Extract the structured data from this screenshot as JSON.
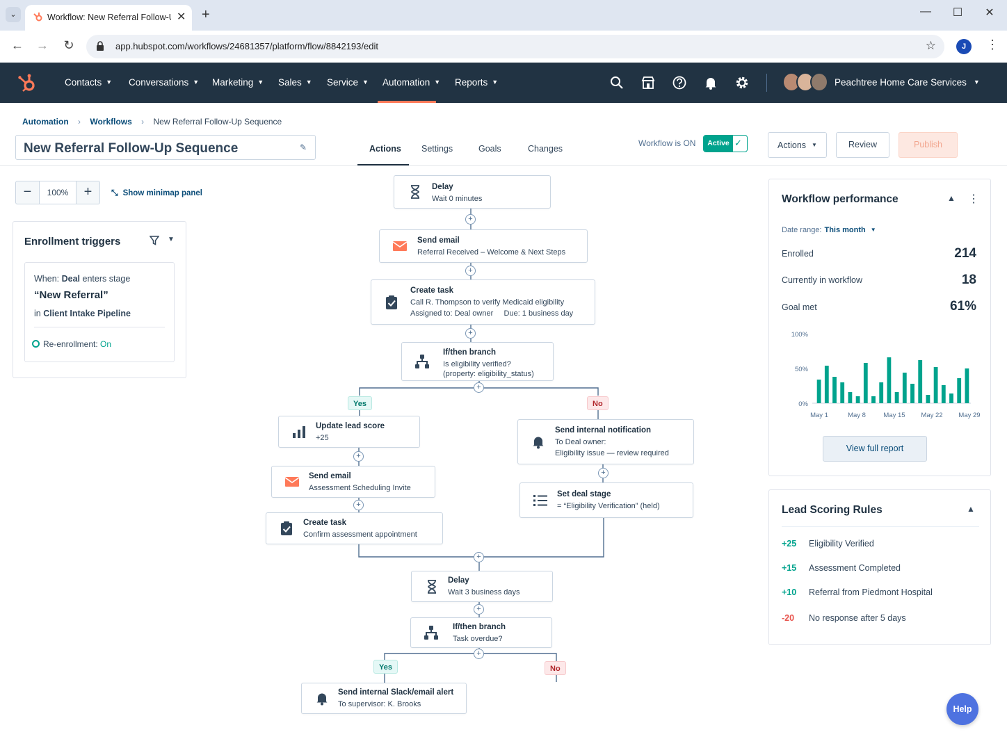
{
  "browser": {
    "tab_title": "Workflow: New Referral Follow-Up",
    "url": "app.hubspot.com/workflows/24681357/platform/flow/8842193/edit",
    "profile_initial": "J"
  },
  "nav": {
    "items": [
      {
        "label": "Contacts"
      },
      {
        "label": "Conversations"
      },
      {
        "label": "Marketing"
      },
      {
        "label": "Sales"
      },
      {
        "label": "Service"
      },
      {
        "label": "Automation"
      },
      {
        "label": "Reports"
      }
    ],
    "active": "Automation",
    "account_name": "Peachtree Home Care Services"
  },
  "breadcrumb": {
    "root": "Automation",
    "section": "Workflows",
    "current": "New Referral Follow-Up Sequence"
  },
  "workflow": {
    "title": "New Referral Follow-Up Sequence",
    "tabs": [
      "Actions",
      "Settings",
      "Goals",
      "Changes"
    ],
    "active_tab": "Actions",
    "status_text": "Workflow is ON",
    "toggle_label": "Active",
    "buttons": {
      "actions": "Actions",
      "review": "Review",
      "publish": "Publish"
    }
  },
  "zoom": {
    "value": "100%",
    "minimap_label": "Show minimap panel"
  },
  "enrollment": {
    "title": "Enrollment triggers",
    "when_prefix": "When:",
    "object": "Deal",
    "action": "enters stage",
    "stage": "“New Referral”",
    "in_prefix": "in",
    "pipeline": "Client Intake Pipeline",
    "reenroll_label": "Re-enrollment:",
    "reenroll_value": "On"
  },
  "flow": {
    "delay1": {
      "title": "Delay",
      "sub": "Wait 0 minutes"
    },
    "email1": {
      "title": "Send email",
      "sub": "Referral Received – Welcome & Next Steps"
    },
    "task1": {
      "title": "Create task",
      "sub1": "Call R. Thompson to verify Medicaid eligibility",
      "sub2": "Assigned to: Deal owner     Due: 1 business day"
    },
    "branch1": {
      "title": "If/then branch",
      "sub1": "Is eligibility verified?",
      "sub2": "(property: eligibility_status)"
    },
    "yes1": "Yes",
    "no1": "No",
    "lead_score": {
      "title": "Update lead score",
      "sub": "+25"
    },
    "email2": {
      "title": "Send email",
      "sub": "Assessment Scheduling Invite"
    },
    "task2": {
      "title": "Create task",
      "sub": "Confirm assessment appointment"
    },
    "notify": {
      "title": "Send internal notification",
      "sub1": "To Deal owner:",
      "sub2": "Eligibility issue — review required"
    },
    "deal_stage": {
      "title": "Set deal stage",
      "sub": "= “Eligibility Verification” (held)"
    },
    "delay2": {
      "title": "Delay",
      "sub": "Wait 3 business days"
    },
    "branch2": {
      "title": "If/then branch",
      "sub": "Task overdue?"
    },
    "yes2": "Yes",
    "no2": "No",
    "alert": {
      "title": "Send internal Slack/email alert",
      "sub": "To supervisor: K. Brooks"
    }
  },
  "performance": {
    "title": "Workflow performance",
    "date_range_label": "Date range:",
    "date_range_value": "This month",
    "metrics": [
      {
        "label": "Enrolled",
        "value": "214"
      },
      {
        "label": "Currently in workflow",
        "value": "18"
      },
      {
        "label": "Goal met",
        "value": "61%"
      }
    ],
    "report_button": "View full report"
  },
  "chart_data": {
    "type": "bar",
    "title": "",
    "y_ticks": [
      "100%",
      "50%",
      "0%"
    ],
    "ylim": [
      0,
      100
    ],
    "x_tick_labels": [
      "May 1",
      "May 8",
      "May 15",
      "May 22",
      "May 29"
    ],
    "values": [
      34,
      54,
      38,
      30,
      16,
      10,
      58,
      10,
      30,
      66,
      16,
      44,
      28,
      62,
      12,
      52,
      26,
      14,
      36,
      50
    ],
    "color": "#00a38d"
  },
  "lead_scoring": {
    "title": "Lead Scoring Rules",
    "rules": [
      {
        "points": "+25",
        "label": "Eligibility Verified",
        "color": "#00a38d"
      },
      {
        "points": "+15",
        "label": "Assessment Completed",
        "color": "#00a38d"
      },
      {
        "points": "+10",
        "label": "Referral from Piedmont Hospital",
        "color": "#00a38d"
      },
      {
        "points": "-20",
        "label": "No response after 5 days",
        "color": "#e8554e"
      }
    ]
  },
  "help_label": "Help",
  "colors": {
    "nav_bg": "#213343",
    "accent": "#ff7a59",
    "success": "#00a38d",
    "link": "#0b4d79"
  }
}
